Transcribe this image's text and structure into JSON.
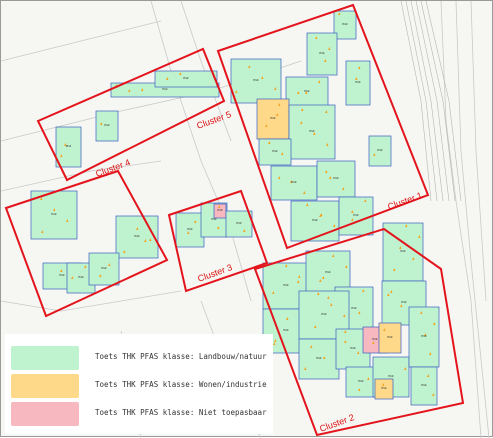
{
  "colors": {
    "landbouw": "#bff2cf",
    "wonen": "#ffd98a",
    "niet": "#f7b8c0",
    "cluster_border": "#e3141c",
    "plot_border": "#3b5fc4",
    "marker": "#f2a520"
  },
  "legend": {
    "items": [
      {
        "key": "landbouw",
        "label": "Toets THK PFAS klasse: Landbouw/natuur"
      },
      {
        "key": "wonen",
        "label": "Toets THK PFAS klasse: Wonen/industrie"
      },
      {
        "key": "niet",
        "label": "Toets THK PFAS klasse: Niet toepasbaar"
      }
    ]
  },
  "clusters": [
    {
      "id": "1",
      "label": "Cluster 1"
    },
    {
      "id": "2",
      "label": "Cluster 2"
    },
    {
      "id": "3",
      "label": "Cluster 3"
    },
    {
      "id": "4",
      "label": "Cluster 4"
    },
    {
      "id": "5",
      "label": "Cluster 5"
    }
  ],
  "plot_label": "Plot"
}
